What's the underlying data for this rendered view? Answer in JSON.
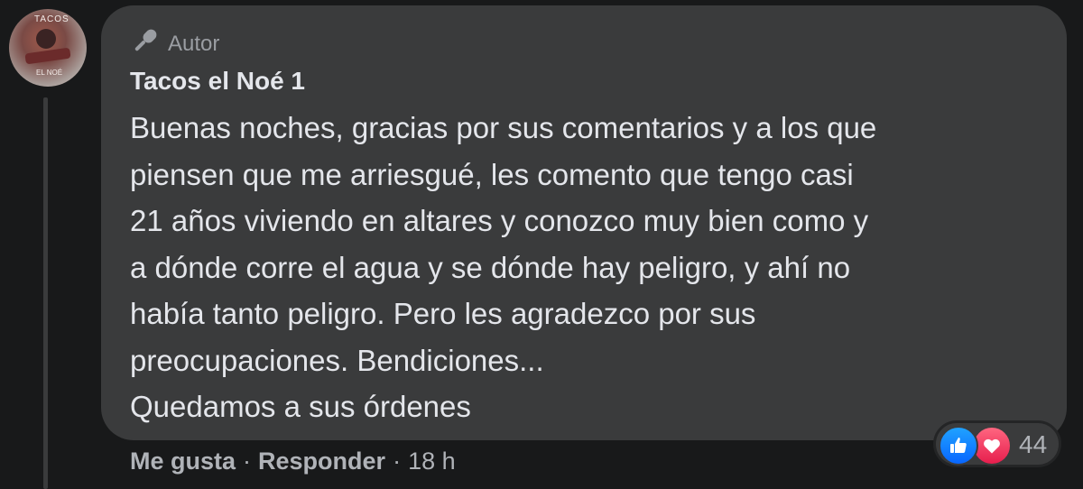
{
  "comment": {
    "badge_label": "Autor",
    "author_name": "Tacos el Noé 1",
    "message_lines": [
      "Buenas noches, gracias por sus comentarios y a los que",
      "piensen que me arriesgué, les comento que tengo casi",
      "21 años viviendo en altares y conozco muy bien como y",
      "a dónde corre el agua y se dónde hay peligro, y ahí no",
      "había tanto peligro. Pero les agradezco por sus",
      "preocupaciones. Bendiciones...",
      "Quedamos a sus órdenes"
    ],
    "avatar_text_top": "TACOS",
    "avatar_text_bottom": "EL NOÉ"
  },
  "actions": {
    "like_label": "Me gusta",
    "separator": "·",
    "reply_label": "Responder",
    "time": "18 h"
  },
  "reactions": {
    "types": [
      "like-icon",
      "love-icon"
    ],
    "count": "44"
  },
  "colors": {
    "background": "#18191a",
    "bubble": "#3a3b3c",
    "text": "#e4e6eb",
    "secondary_text": "#b0b3b8",
    "like_blue": "#0866ff",
    "love_red": "#e61e4d"
  }
}
